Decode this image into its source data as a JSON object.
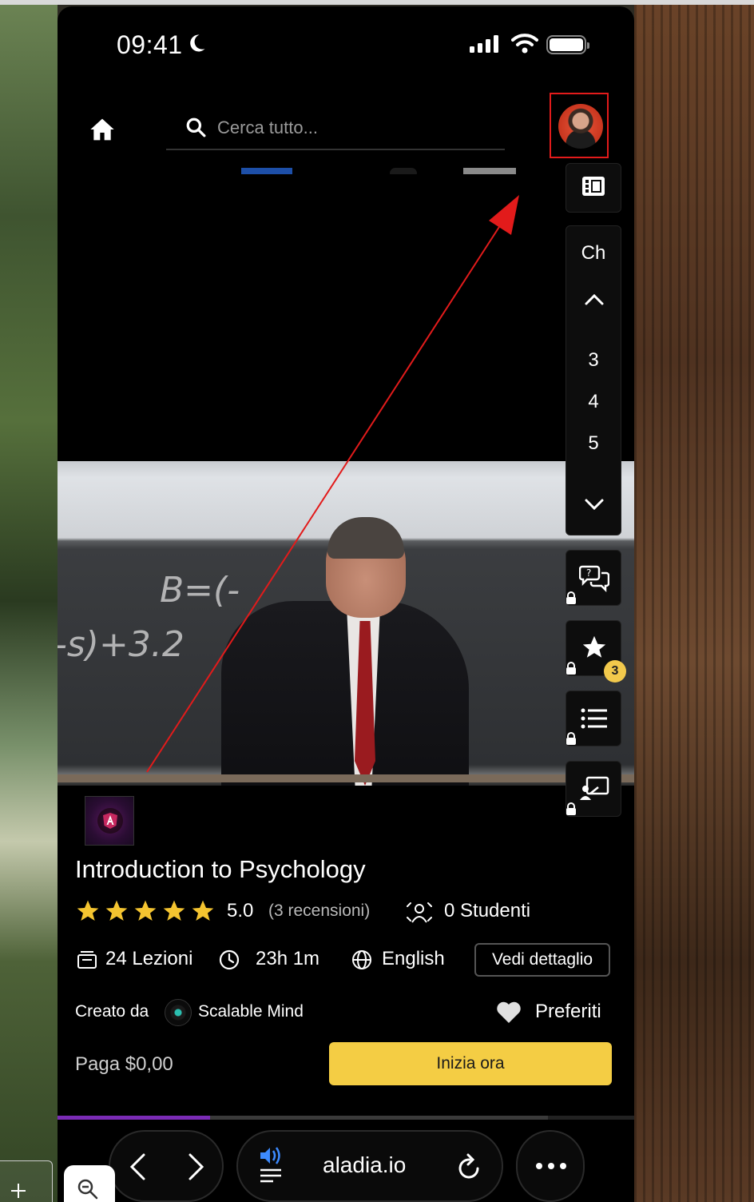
{
  "status_bar": {
    "time": "09:41"
  },
  "header": {
    "search_placeholder": "Cerca tutto..."
  },
  "chapters_panel": {
    "label": "Ch",
    "numbers": [
      "3",
      "4",
      "5"
    ]
  },
  "favorites_badge": "3",
  "course": {
    "title": "Introduction to Psychology",
    "rating": "5.0",
    "stars_count": 5,
    "reviews": "(3 recensioni)",
    "students": "0 Studenti",
    "lessons": "24 Lezioni",
    "duration": "23h 1m",
    "language": "English",
    "detail_label": "Vedi dettaglio",
    "created_by_label": "Creato da",
    "creator": "Scalable Mind",
    "favorites_label": "Preferiti",
    "price": "Paga $0,00",
    "start_label": "Inizia ora"
  },
  "progress": {
    "fraction": 0.265
  },
  "browser": {
    "url": "aladia.io"
  },
  "colors": {
    "accent_yellow": "#f4cd44",
    "progress_purple": "#7a2bb5",
    "annotation_red": "#e21b1b",
    "badge_yellow": "#f2c94c"
  }
}
